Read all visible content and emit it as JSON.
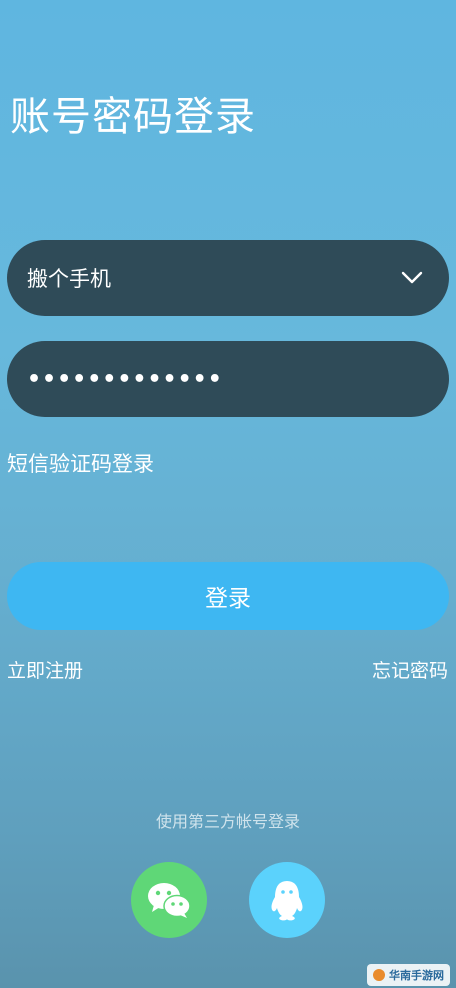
{
  "page": {
    "title": "账号密码登录"
  },
  "form": {
    "phone_value": "搬个手机",
    "password_masked": "•••••••••••••"
  },
  "links": {
    "sms_login": "短信验证码登录",
    "register": "立即注册",
    "forgot_password": "忘记密码"
  },
  "buttons": {
    "login": "登录"
  },
  "third_party": {
    "label": "使用第三方帐号登录",
    "providers": [
      "wechat",
      "qq"
    ]
  },
  "watermark": {
    "text": "华南手游网"
  },
  "colors": {
    "field_background": "#2f4b58",
    "login_button": "#3eb7f2",
    "wechat": "#5fd777",
    "qq": "#5bd2fc"
  }
}
